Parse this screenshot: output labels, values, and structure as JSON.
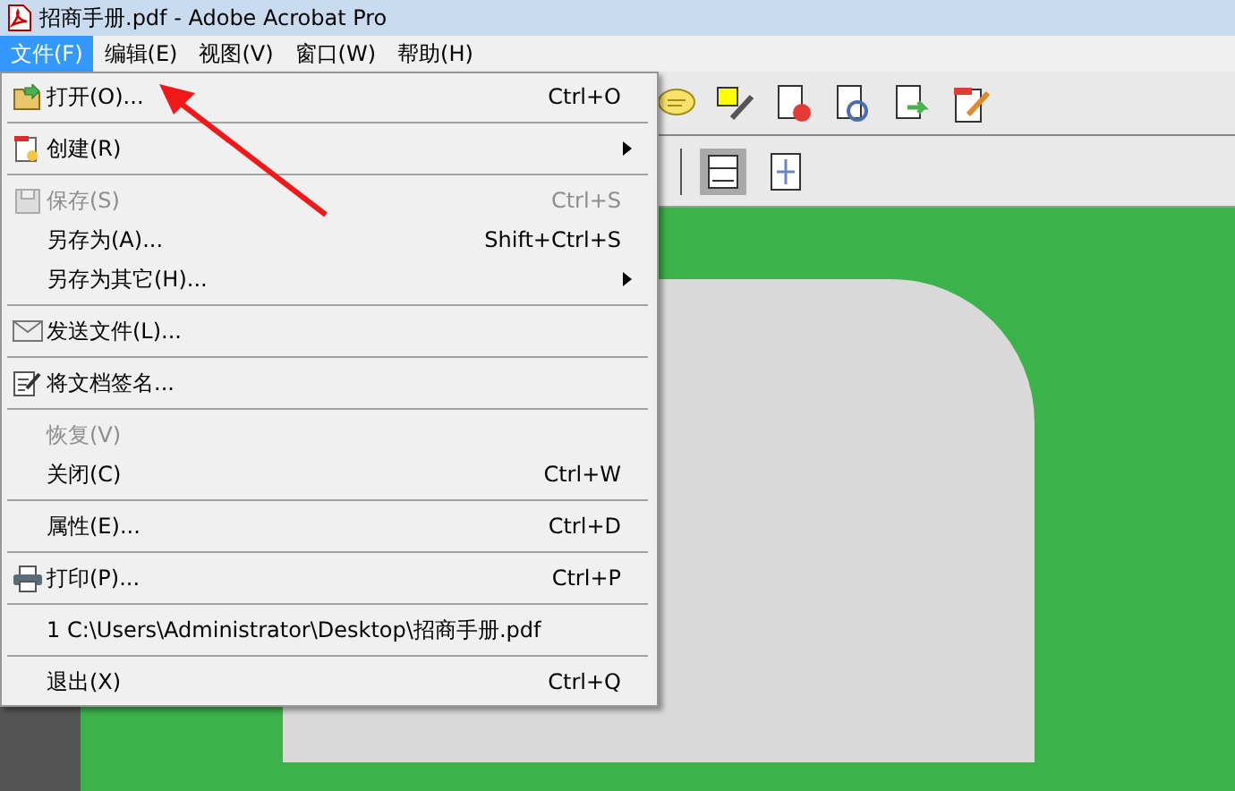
{
  "window": {
    "title": "招商手册.pdf - Adobe Acrobat Pro"
  },
  "menubar": [
    {
      "label": "文件(F)",
      "selected": true
    },
    {
      "label": "编辑(E)",
      "selected": false
    },
    {
      "label": "视图(V)",
      "selected": false
    },
    {
      "label": "窗口(W)",
      "selected": false
    },
    {
      "label": "帮助(H)",
      "selected": false
    }
  ],
  "file_menu": [
    {
      "kind": "item",
      "label": "打开(O)...",
      "shortcut": "Ctrl+O",
      "disabled": false,
      "submenu": false
    },
    {
      "kind": "separator"
    },
    {
      "kind": "item",
      "label": "创建(R)",
      "disabled": false,
      "submenu": true
    },
    {
      "kind": "separator"
    },
    {
      "kind": "item",
      "label": "保存(S)",
      "shortcut": "Ctrl+S",
      "disabled": true,
      "submenu": false
    },
    {
      "kind": "item",
      "label": "另存为(A)...",
      "shortcut": "Shift+Ctrl+S",
      "disabled": false,
      "submenu": false
    },
    {
      "kind": "item",
      "label": "另存为其它(H)...",
      "disabled": false,
      "submenu": true
    },
    {
      "kind": "separator"
    },
    {
      "kind": "item",
      "label": "发送文件(L)...",
      "disabled": false,
      "submenu": false
    },
    {
      "kind": "separator"
    },
    {
      "kind": "item",
      "label": "将文档签名...",
      "disabled": false,
      "submenu": false
    },
    {
      "kind": "separator"
    },
    {
      "kind": "item",
      "label": "恢复(V)",
      "disabled": true,
      "submenu": false
    },
    {
      "kind": "item",
      "label": "关闭(C)",
      "shortcut": "Ctrl+W",
      "disabled": false,
      "submenu": false
    },
    {
      "kind": "separator"
    },
    {
      "kind": "item",
      "label": "属性(E)...",
      "shortcut": "Ctrl+D",
      "disabled": false,
      "submenu": false
    },
    {
      "kind": "separator"
    },
    {
      "kind": "item",
      "label": "打印(P)...",
      "shortcut": "Ctrl+P",
      "disabled": false,
      "submenu": false
    },
    {
      "kind": "separator"
    },
    {
      "kind": "item",
      "label": "1 C:\\Users\\Administrator\\Desktop\\招商手册.pdf",
      "disabled": false,
      "submenu": false
    },
    {
      "kind": "separator"
    },
    {
      "kind": "item",
      "label": "退出(X)",
      "shortcut": "Ctrl+Q",
      "disabled": false,
      "submenu": false
    }
  ]
}
